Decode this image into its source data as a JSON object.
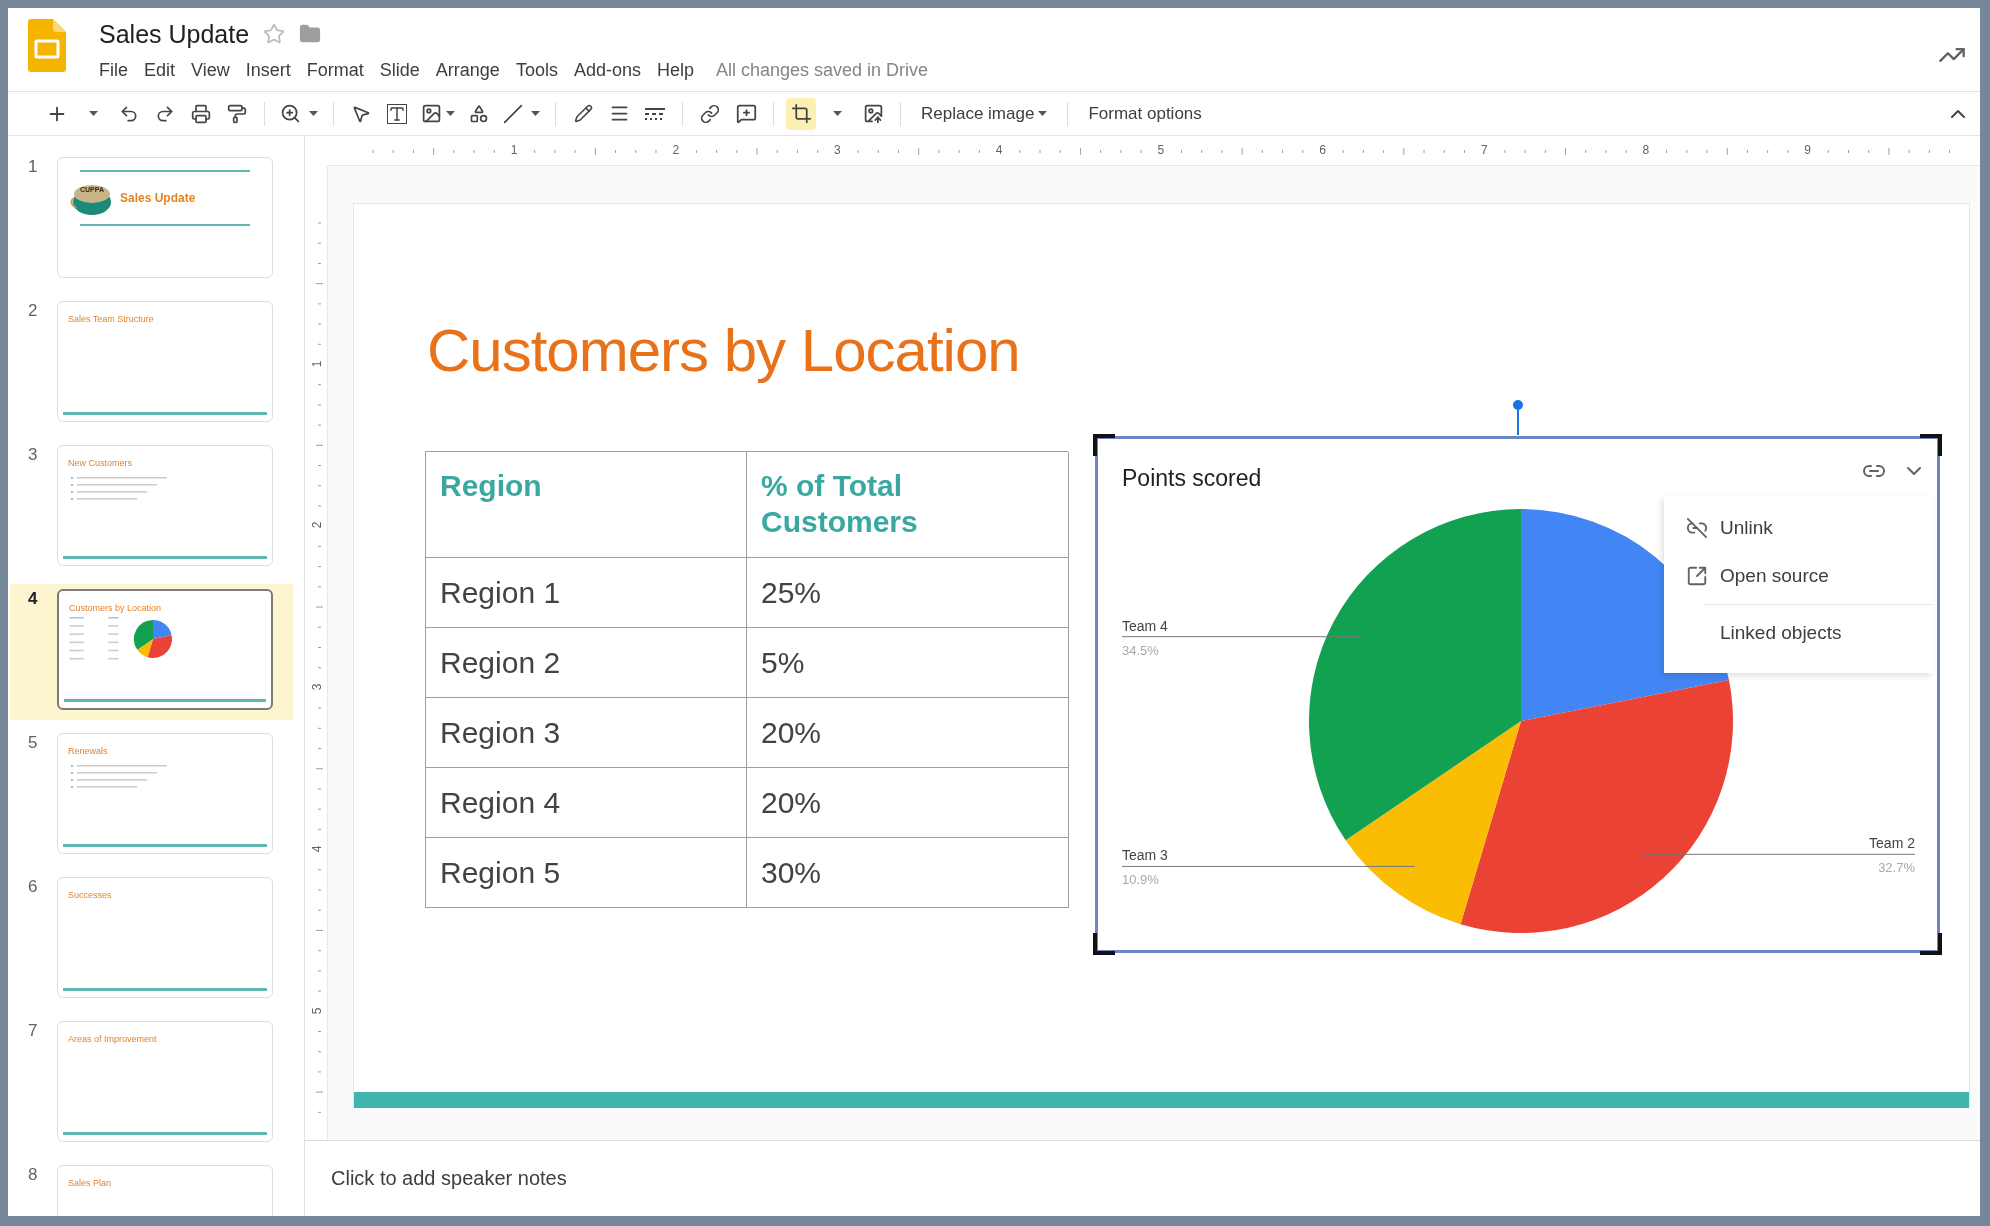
{
  "header": {
    "title": "Sales Update",
    "starred": false,
    "menu": [
      "File",
      "Edit",
      "View",
      "Insert",
      "Format",
      "Slide",
      "Arrange",
      "Tools",
      "Add-ons",
      "Help"
    ],
    "save_status": "All changes saved in Drive"
  },
  "toolbar": {
    "crop_active": true,
    "text_buttons": [
      {
        "label": "Replace image",
        "kind": "dropdown"
      },
      {
        "label": "Format options",
        "kind": "plain"
      }
    ]
  },
  "ruler": {
    "horizontal": [
      "1",
      "2",
      "3",
      "4",
      "5",
      "6",
      "7",
      "8",
      "9"
    ],
    "vertical": [
      "1",
      "2",
      "3",
      "4",
      "5"
    ]
  },
  "slides": [
    {
      "number": "1",
      "title": "Sales Update",
      "kind": "title",
      "logo_text": "CUPPA",
      "selected": false
    },
    {
      "number": "2",
      "title": "Sales Team Structure",
      "kind": "heading",
      "selected": false
    },
    {
      "number": "3",
      "title": "New Customers",
      "kind": "bullets",
      "selected": false
    },
    {
      "number": "4",
      "title": "Customers by Location",
      "kind": "table_chart",
      "selected": true
    },
    {
      "number": "5",
      "title": "Renewals",
      "kind": "bullets",
      "selected": false
    },
    {
      "number": "6",
      "title": "Successes",
      "kind": "heading",
      "selected": false
    },
    {
      "number": "7",
      "title": "Areas of Improvement",
      "kind": "heading",
      "selected": false
    },
    {
      "number": "8",
      "title": "Sales Plan",
      "kind": "heading",
      "selected": false
    }
  ],
  "current_slide": {
    "title": "Customers by Location",
    "table": {
      "columns": [
        "Region",
        "% of Total Customers"
      ],
      "rows": [
        [
          "Region 1",
          "25%"
        ],
        [
          "Region 2",
          "5%"
        ],
        [
          "Region 3",
          "20%"
        ],
        [
          "Region 4",
          "20%"
        ],
        [
          "Region 5",
          "30%"
        ]
      ]
    },
    "chart": {
      "selected": true,
      "menu_open": true,
      "menu": [
        {
          "label": "Unlink",
          "kind": "unlink"
        },
        {
          "label": "Open source",
          "kind": "open"
        },
        {
          "label": "Linked objects",
          "kind": "plain"
        }
      ],
      "chart_data": {
        "type": "pie",
        "title": "Points scored",
        "categories": [
          null,
          "Team 2",
          "Team 3",
          "Team 4"
        ],
        "values": [
          21.9,
          32.7,
          10.9,
          34.5
        ],
        "colors": [
          "#4285f4",
          "#ea4335",
          "#fbbc04",
          "#12a150"
        ],
        "value_labels": [
          null,
          "32.7%",
          "10.9%",
          "34.5%"
        ]
      }
    }
  },
  "notes": {
    "placeholder": "Click to add speaker notes"
  }
}
